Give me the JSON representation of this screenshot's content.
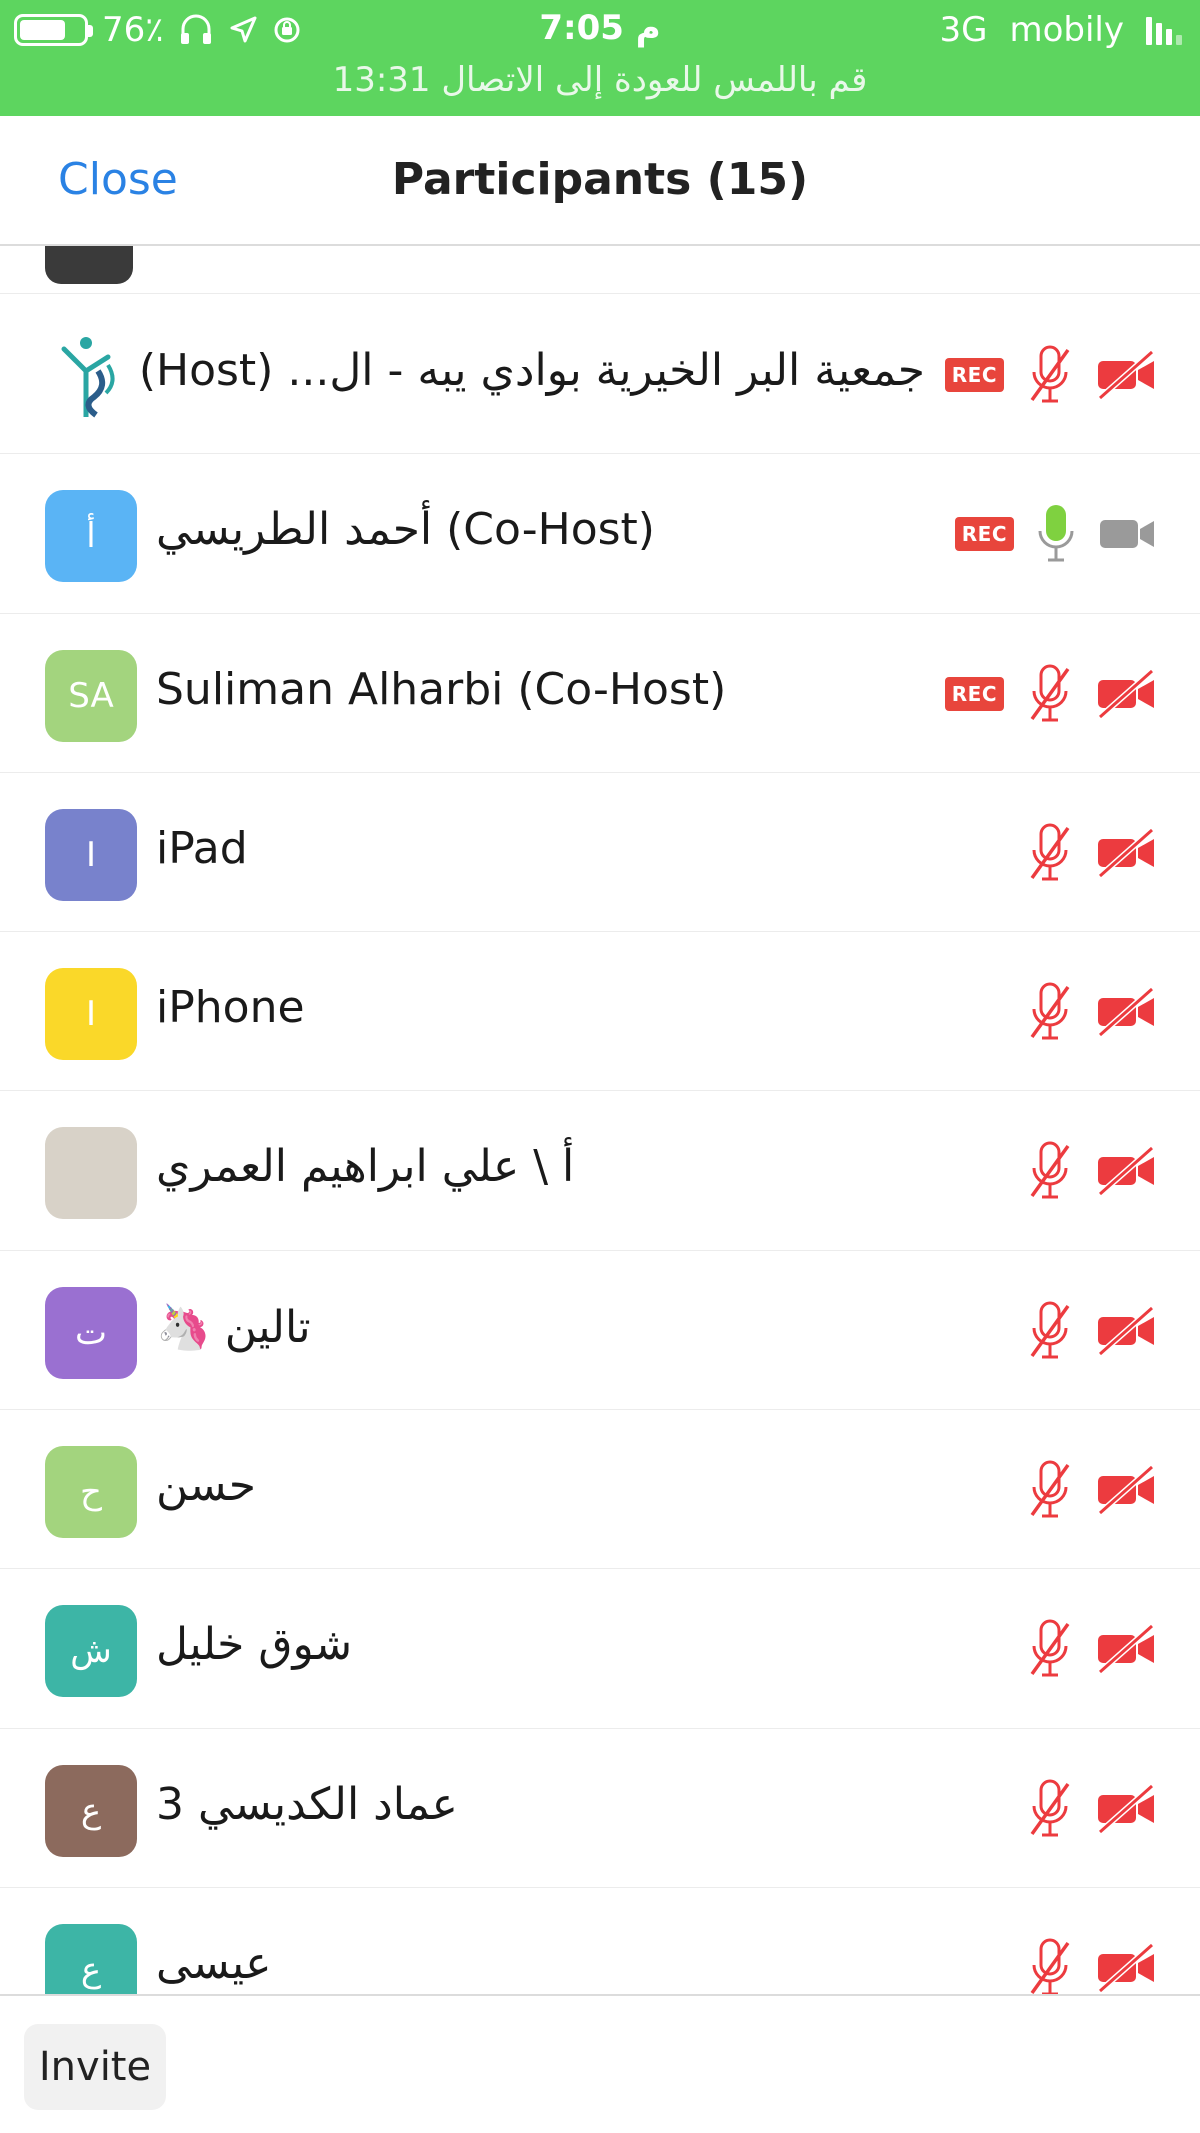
{
  "status_bar": {
    "battery": "76٪",
    "battery_level": 0.76,
    "time": "7:05 م",
    "network": "3G",
    "carrier": "mobily",
    "return_banner": "قم باللمس للعودة إلى الاتصال 13:31"
  },
  "header": {
    "close_label": "Close",
    "title": "Participants (15)"
  },
  "participants": [
    {
      "name": "جمعية البر الخيرية بوادي يبه - ال...",
      "role": "(Host)",
      "avatar": "",
      "avatar_color": "#ffffff",
      "rec": "REC",
      "mic": "muted",
      "video": "off"
    },
    {
      "name": "أحمد الطريسي",
      "role": "(Co-Host)",
      "avatar": "أ",
      "avatar_color": "#5ab4f5",
      "rec": "REC",
      "mic": "on",
      "video": "idle"
    },
    {
      "name": "Suliman Alharbi",
      "role": "(Co-Host)",
      "avatar": "SA",
      "avatar_color": "#a3d47e",
      "rec": "REC",
      "mic": "muted",
      "video": "off"
    },
    {
      "name": "iPad",
      "role": "",
      "avatar": "I",
      "avatar_color": "#7882cc",
      "rec": "",
      "mic": "muted",
      "video": "off"
    },
    {
      "name": "iPhone",
      "role": "",
      "avatar": "I",
      "avatar_color": "#fad829",
      "rec": "",
      "mic": "muted",
      "video": "off"
    },
    {
      "name": "أ \\ علي ابراهيم العمري",
      "role": "",
      "avatar": "",
      "avatar_color": "#d8d2c8",
      "rec": "",
      "mic": "muted",
      "video": "off"
    },
    {
      "name": "تالين 🦄",
      "role": "",
      "avatar": "ت",
      "avatar_color": "#9a70d1",
      "rec": "",
      "mic": "muted",
      "video": "off"
    },
    {
      "name": "حسن",
      "role": "",
      "avatar": "ح",
      "avatar_color": "#a3d47e",
      "rec": "",
      "mic": "muted",
      "video": "off"
    },
    {
      "name": "شوق خليل",
      "role": "",
      "avatar": "ش",
      "avatar_color": "#3db5a6",
      "rec": "",
      "mic": "muted",
      "video": "off"
    },
    {
      "name": "عماد الكديسي 3",
      "role": "",
      "avatar": "ع",
      "avatar_color": "#8c6a5d",
      "rec": "",
      "mic": "muted",
      "video": "off"
    },
    {
      "name": "عيسى",
      "role": "",
      "avatar": "ع",
      "avatar_color": "#3db5a6",
      "rec": "",
      "mic": "muted",
      "video": "off"
    }
  ],
  "footer": {
    "invite_label": "Invite"
  },
  "colors": {
    "accent": "#2a82e4",
    "status_green": "#5dd55f",
    "muted_red": "#ec3b3f",
    "mic_green": "#7fd140",
    "video_grey": "#9a9a9a"
  }
}
